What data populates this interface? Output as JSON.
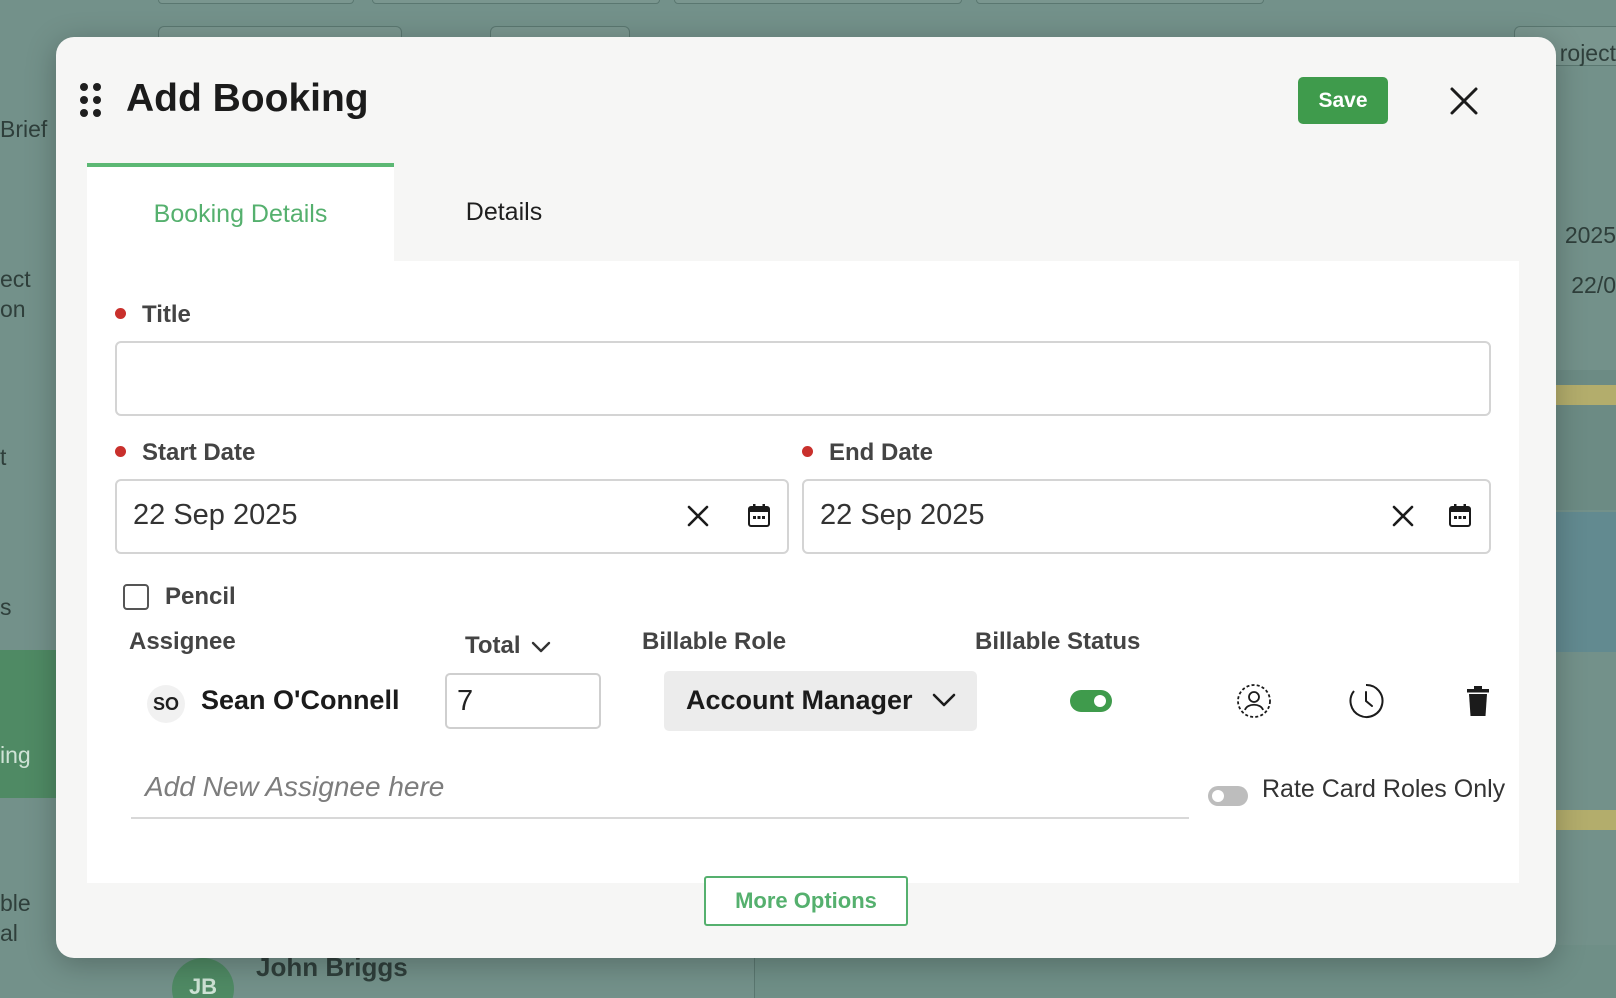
{
  "background": {
    "left_fragments": [
      "Brief",
      "ect",
      "on",
      "t",
      "s",
      "ing",
      "ble",
      "al"
    ],
    "right_fragments": [
      "roject",
      "2025",
      "22/0"
    ],
    "row_avatar_initials": "JB",
    "row_name": "John Briggs"
  },
  "modal": {
    "title": "Add Booking",
    "save_label": "Save",
    "tabs": [
      {
        "label": "Booking Details",
        "active": true
      },
      {
        "label": "Details",
        "active": false
      }
    ],
    "fields": {
      "title_label": "Title",
      "title_value": "",
      "start_date_label": "Start Date",
      "start_date_value": "22 Sep 2025",
      "end_date_label": "End Date",
      "end_date_value": "22 Sep 2025",
      "pencil_label": "Pencil",
      "pencil_checked": false
    },
    "assignees": {
      "headers": {
        "assignee": "Assignee",
        "total": "Total",
        "billable_role": "Billable Role",
        "billable_status": "Billable Status"
      },
      "rows": [
        {
          "initials": "SO",
          "name": "Sean O'Connell",
          "total": "7",
          "billable_role": "Account Manager",
          "billable_status": true
        }
      ],
      "add_placeholder": "Add New Assignee here",
      "rate_card_label": "Rate Card Roles Only",
      "rate_card_enabled": false
    },
    "more_options_label": "More Options"
  },
  "colors": {
    "accent_green": "#3f9b4c",
    "tab_green": "#55b06e",
    "required_red": "#c9302c",
    "backdrop": "#73918a"
  }
}
